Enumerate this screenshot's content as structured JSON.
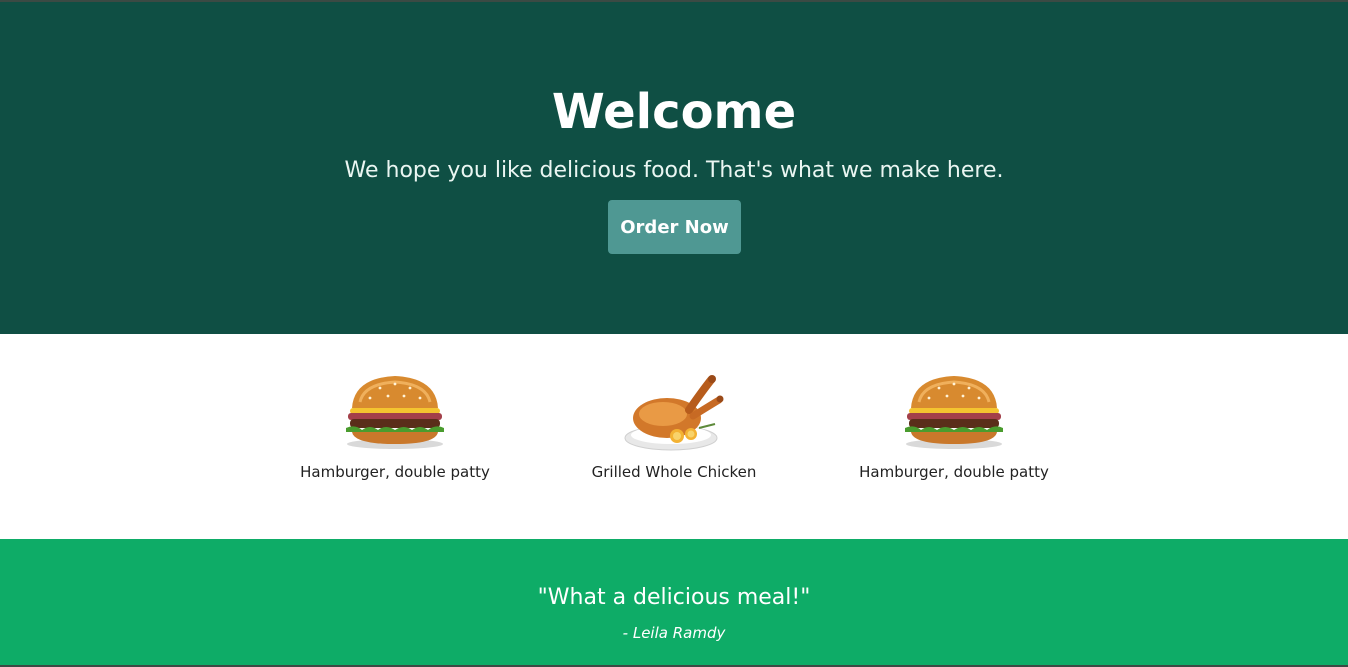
{
  "hero": {
    "title": "Welcome",
    "subtitle": "We hope you like delicious food. That's what we make here.",
    "button_label": "Order Now"
  },
  "menu": {
    "items": [
      {
        "name": "Hamburger, double patty",
        "icon": "hamburger-image"
      },
      {
        "name": "Grilled Whole Chicken",
        "icon": "roast-chicken-image"
      },
      {
        "name": "Hamburger, double patty",
        "icon": "hamburger-image"
      }
    ]
  },
  "testimonial": {
    "quote": "\"What a delicious meal!\"",
    "author": "- Leila Ramdy"
  },
  "colors": {
    "hero_bg": "#0f4f44",
    "button_bg": "#4f9893",
    "testimonial_bg": "#0eac67"
  }
}
